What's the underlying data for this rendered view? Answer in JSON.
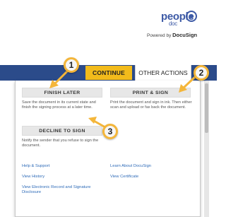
{
  "brand": {
    "logo_word": "people",
    "logo_sub": "doc",
    "powered_by": "Powered by",
    "powered_brand": "DocuSign",
    "accent": "#f2bb1b",
    "nav_color": "#2b4b8a",
    "link_color": "#2e6bb8"
  },
  "toolbar": {
    "continue_label": "CONTINUE",
    "other_actions_label": "OTHER ACTIONS"
  },
  "menu": {
    "finish_later": {
      "label": "FINISH LATER",
      "description": "Save the document in its current state and finish the signing process at a later time."
    },
    "print_sign": {
      "label": "PRINT & SIGN",
      "description": "Print the document and sign in ink. Then either scan and upload or fax back the document."
    },
    "decline": {
      "label": "DECLINE TO SIGN",
      "description": "Notify the sender that you refuse to sign the document."
    },
    "links": {
      "help": "Help & Support",
      "learn": "Learn About DocuSign",
      "history": "View History",
      "certificate": "View Certificate",
      "disclosure": "View Electronic Record and Signature Disclosure"
    }
  },
  "callouts": [
    "1",
    "2",
    "3"
  ]
}
